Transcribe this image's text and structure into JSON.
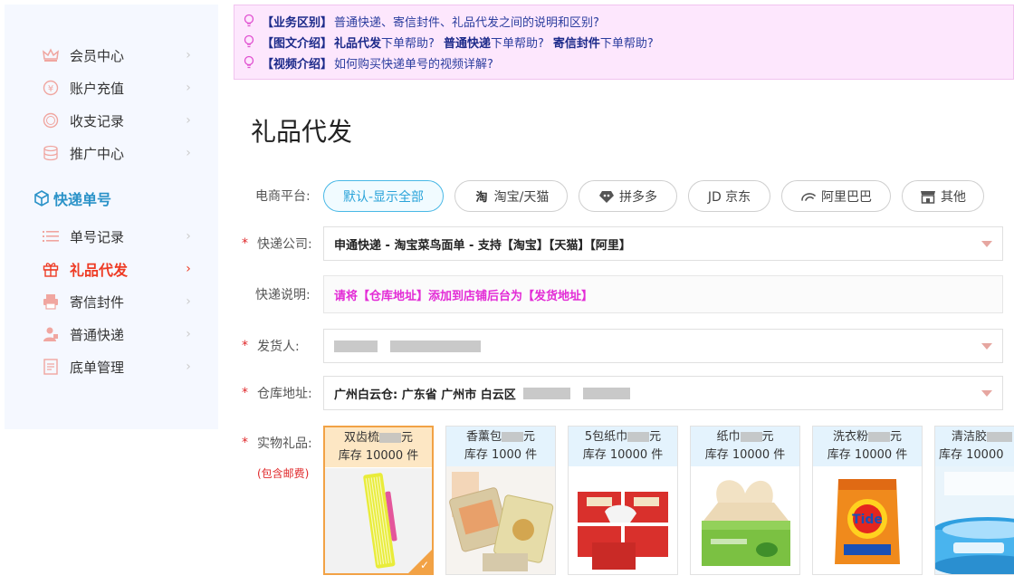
{
  "sidebar": {
    "items_top": [
      {
        "label": "会员中心",
        "icon": "crown-icon"
      },
      {
        "label": "账户充值",
        "icon": "recharge-icon"
      },
      {
        "label": "收支记录",
        "icon": "yen-coin-icon"
      },
      {
        "label": "推广中心",
        "icon": "coins-stack-icon"
      }
    ],
    "section_title": "快递单号",
    "items_bottom": [
      {
        "label": "单号记录",
        "icon": "list-icon"
      },
      {
        "label": "礼品代发",
        "icon": "gift-icon",
        "active": true
      },
      {
        "label": "寄信封件",
        "icon": "printer-icon"
      },
      {
        "label": "普通快递",
        "icon": "person-icon"
      },
      {
        "label": "底单管理",
        "icon": "document-icon"
      }
    ],
    "chevron": "›"
  },
  "notice": {
    "line1": {
      "tag": "【业务区别】",
      "text": "普通快递、寄信封件、礼品代发之间的说明和区别?"
    },
    "line2": {
      "tag": "【图文介绍】",
      "link1": "礼品代发",
      "text1": "下单帮助?",
      "link2": "普通快递",
      "text2": "下单帮助?",
      "link3": "寄信封件",
      "text3": "下单帮助?"
    },
    "line3": {
      "tag": "【视频介绍】",
      "text": "如何购买快递单号的视频详解?"
    }
  },
  "page_title": "礼品代发",
  "form": {
    "platform_label": "电商平台:",
    "platforms": [
      {
        "label": "默认-显示全部",
        "icon": "",
        "active": true
      },
      {
        "label": "淘宝/天猫",
        "icon": "taobao-icon"
      },
      {
        "label": "拼多多",
        "icon": "pinduoduo-icon"
      },
      {
        "label": "JD 京东",
        "icon": ""
      },
      {
        "label": "阿里巴巴",
        "icon": "alibaba-icon"
      },
      {
        "label": "其他",
        "icon": "store-icon"
      }
    ],
    "courier_label": "快递公司:",
    "courier_value": "申通快递 - 淘宝菜鸟面单 - 支持【淘宝】【天猫】【阿里】",
    "desc_label": "快递说明:",
    "desc_value": "请将【仓库地址】添加到店铺后台为【发货地址】",
    "sender_label": "发货人:",
    "warehouse_label": "仓库地址:",
    "warehouse_value": "广州白云仓: 广东省 广州市 白云区",
    "gift_label": "实物礼品:",
    "gift_note": "(包含邮费)",
    "required_mark": "*"
  },
  "gifts": [
    {
      "name": "双齿梳",
      "price_suffix": "元",
      "stock": "库存 10000 件",
      "selected": true,
      "image": "comb"
    },
    {
      "name": "香薰包",
      "price_suffix": "元",
      "stock": "库存 1000 件",
      "selected": false,
      "image": "sachet"
    },
    {
      "name": "5包纸巾",
      "price_suffix": "元",
      "stock": "库存 10000 件",
      "selected": false,
      "image": "tissue-packs"
    },
    {
      "name": "纸巾",
      "price_suffix": "元",
      "stock": "库存 10000 件",
      "selected": false,
      "image": "tissue-box"
    },
    {
      "name": "洗衣粉",
      "price_suffix": "元",
      "stock": "库存 10000 件",
      "selected": false,
      "image": "detergent"
    },
    {
      "name": "清洁胶",
      "price_suffix": "",
      "stock": "库存 10000",
      "selected": false,
      "image": "cleaning-gel"
    }
  ],
  "colors": {
    "accent_red": "#ee3b24",
    "accent_blue": "#2a92c8",
    "notice_bg": "#fde7fd",
    "desc_magenta": "#e32bd6",
    "selected_orange": "#f2a245"
  }
}
